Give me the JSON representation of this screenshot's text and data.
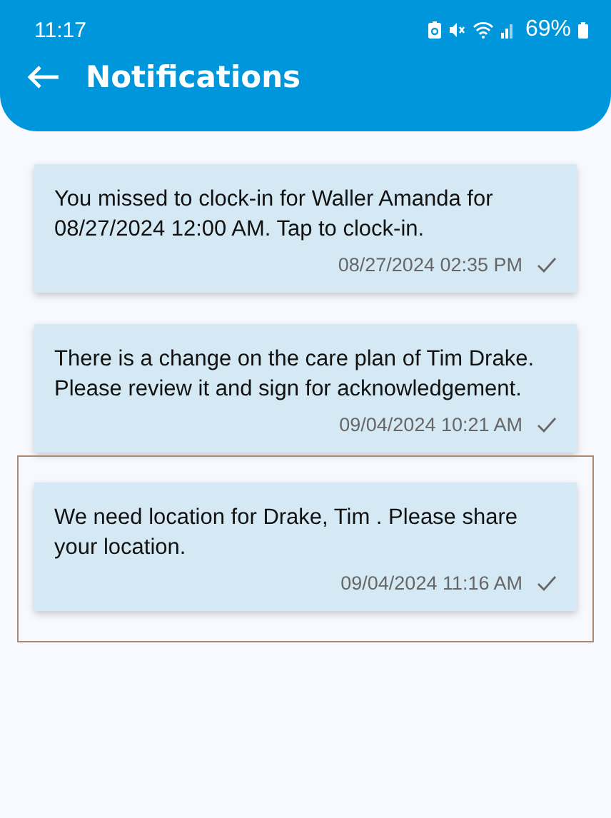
{
  "status_bar": {
    "time": "11:17",
    "battery": "69%"
  },
  "header": {
    "title": "Notifications"
  },
  "notifications": [
    {
      "message": "You missed to clock-in for Waller Amanda for 08/27/2024 12:00 AM. Tap to clock-in.",
      "timestamp": "08/27/2024 02:35 PM",
      "read": true,
      "highlighted": false
    },
    {
      "message": "There is a change on the care plan of Tim Drake. Please review it and sign for acknowledgement.",
      "timestamp": "09/04/2024 10:21 AM",
      "read": true,
      "highlighted": false
    },
    {
      "message": "We need location for Drake, Tim . Please share your location.",
      "timestamp": "09/04/2024 11:16 AM",
      "read": true,
      "highlighted": true
    }
  ]
}
